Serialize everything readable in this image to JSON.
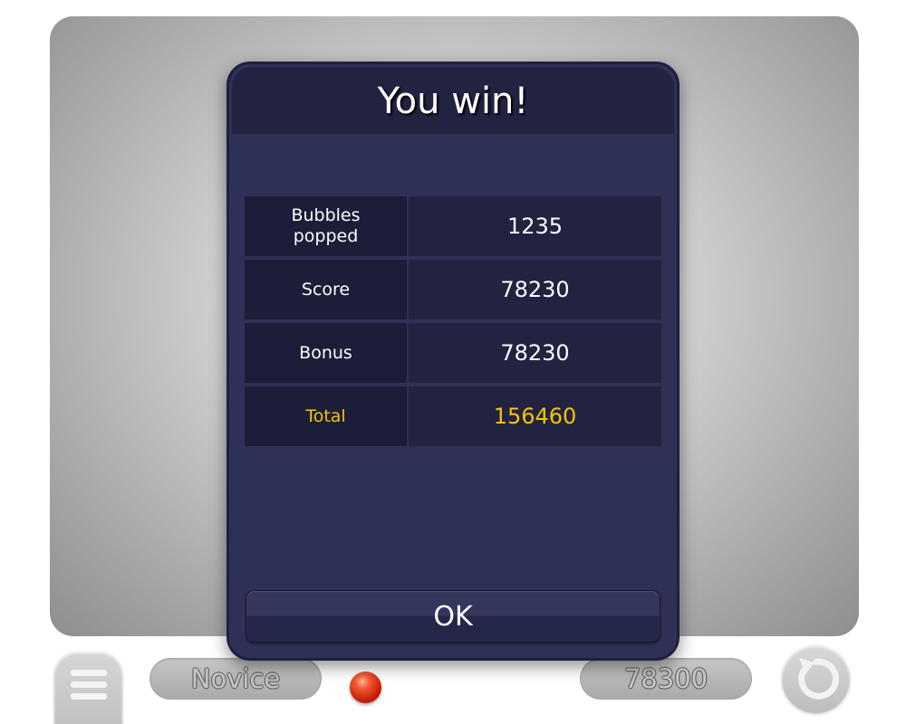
{
  "dialog": {
    "title": "You win!",
    "stats": [
      {
        "label": "Bubbles popped",
        "value": "1235"
      },
      {
        "label": "Score",
        "value": "78230"
      },
      {
        "label": "Bonus",
        "value": "78230"
      },
      {
        "label": "Total",
        "value": "156460"
      }
    ],
    "ok_label": "OK"
  },
  "bottom_bar": {
    "level_label": "Novice",
    "score_value": "78300",
    "menu_icon": "hamburger-menu-icon",
    "restart_icon": "restart-arrow-icon",
    "next_bubble_color": "#d8280c"
  },
  "colors": {
    "dialog_bg": "#2e3056",
    "header_bg": "#212341",
    "total_accent": "#f5c400"
  }
}
